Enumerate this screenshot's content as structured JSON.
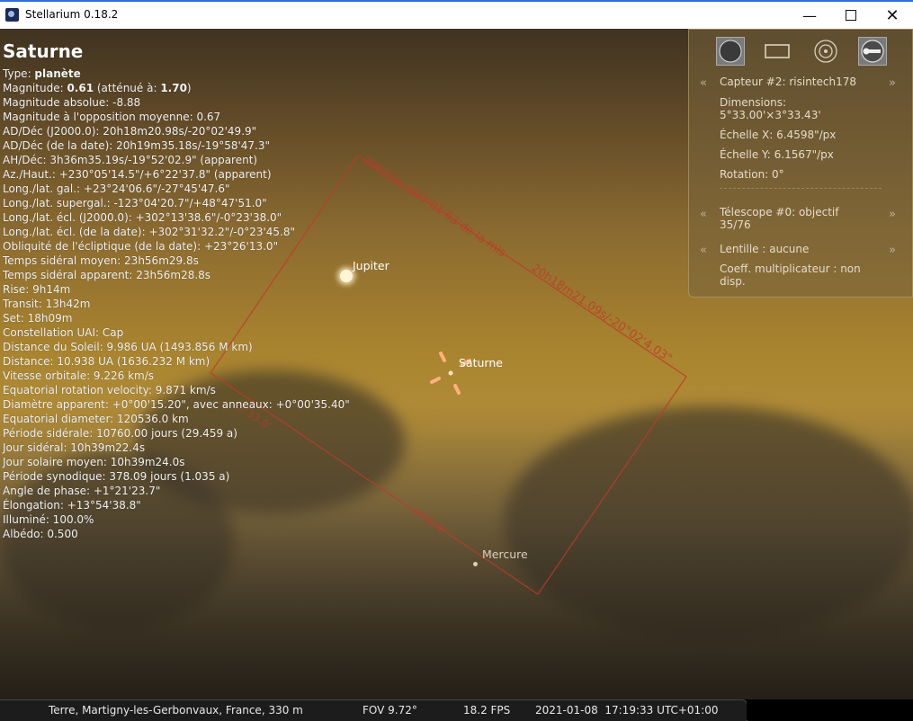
{
  "window": {
    "title": "Stellarium 0.18.2",
    "minimize": "—",
    "close": "✕"
  },
  "info": {
    "name": "Saturne",
    "rows": [
      {
        "label": "Type: ",
        "bold": "planète",
        "rest": ""
      },
      {
        "label": "Magnitude: ",
        "bold": "0.61",
        "rest": " (atténué à: ",
        "bold2": "1.70",
        "rest2": ")"
      },
      {
        "label": "Magnitude absolue: -8.88"
      },
      {
        "label": "Magnitude à l'opposition moyenne: 0.67"
      },
      {
        "label": "AD/Déc (J2000.0): 20h18m20.98s/-20°02'49.9\""
      },
      {
        "label": "AD/Déc (de la date): 20h19m35.18s/-19°58'47.3\""
      },
      {
        "label": "AH/Déc: 3h36m35.19s/-19°52'02.9\" (apparent)"
      },
      {
        "label": "Az./Haut.: +230°05'14.5\"/+6°22'37.8\" (apparent)"
      },
      {
        "label": "Long./lat. gal.: +23°24'06.6\"/-27°45'47.6\""
      },
      {
        "label": "Long./lat. supergal.: -123°04'20.7\"/+48°47'51.0\""
      },
      {
        "label": "Long./lat. écl. (J2000.0): +302°13'38.6\"/-0°23'38.0\""
      },
      {
        "label": "Long./lat. écl. (de la date): +302°31'32.2\"/-0°23'45.8\""
      },
      {
        "label": "Obliquité de l'écliptique (de la date): +23°26'13.0\""
      },
      {
        "label": "Temps sidéral moyen: 23h56m29.8s"
      },
      {
        "label": "Temps sidéral apparent: 23h56m28.8s"
      },
      {
        "label": "Rise: 9h14m"
      },
      {
        "label": "Transit: 13h42m"
      },
      {
        "label": "Set: 18h09m"
      },
      {
        "label": "Constellation UAI: Cap"
      },
      {
        "label": "Distance du Soleil: 9.986 UA (1493.856 M km)"
      },
      {
        "label": "Distance: 10.938 UA (1636.232 M km)"
      },
      {
        "label": "Vitesse orbitale: 9.226 km/s"
      },
      {
        "label": "Equatorial rotation velocity: 9.871 km/s"
      },
      {
        "label": "Diamètre apparent: +0°00'15.20\", avec anneaux: +0°00'35.40\""
      },
      {
        "label": "Equatorial diameter: 120536.0 km"
      },
      {
        "label": "Période sidérale: 10760.00 jours (29.459 a)"
      },
      {
        "label": "Jour sidéral: 10h39m22.4s"
      },
      {
        "label": "Jour solaire moyen: 10h39m24.0s"
      },
      {
        "label": "Période synodique: 378.09 jours (1.035 a)"
      },
      {
        "label": "Angle de phase: +1°21'23.7\""
      },
      {
        "label": "Élongation: +13°54'38.8\""
      },
      {
        "label": "Illuminé: 100.0%"
      },
      {
        "label": "Albédo: 0.500"
      }
    ]
  },
  "sky": {
    "labels": {
      "jupiter": "Jupiter",
      "saturne": "Saturne",
      "mercure": "Mercure"
    },
    "frame_label_top": "20h27m 000°01'63 de la mis",
    "frame_label_right": "20h18m21.09s/-20°02'4.03\"",
    "frame_label_bottom": "5°33.0'",
    "frame_label_side": "3°33.4'"
  },
  "ocular_panel": {
    "sensor": "Capteur #2: risintech178",
    "dimensions_label": "Dimensions:",
    "dimensions_value": "5°33.00'×3°33.43'",
    "scale_x": "Échelle X: 6.4598\"/px",
    "scale_y": "Échelle Y: 6.1567\"/px",
    "rotation": "Rotation: 0°",
    "telescope_line1": "Télescope #0: objectif",
    "telescope_line2": "35/76",
    "lens": "Lentille : aucune",
    "coeff_line1": "Coeff. multiplicateur : non",
    "coeff_line2": "disp.",
    "nav_prev": "«",
    "nav_next": "»"
  },
  "status": {
    "location": "Terre, Martigny-les-Gerbonvaux, France, 330 m",
    "fov": "FOV 9.72°",
    "fps": "18.2 FPS",
    "datetime": "2021-01-08  17:19:33 UTC+01:00"
  },
  "colors": {
    "frame": "#c0392b",
    "accent": "#2b6fd6"
  }
}
